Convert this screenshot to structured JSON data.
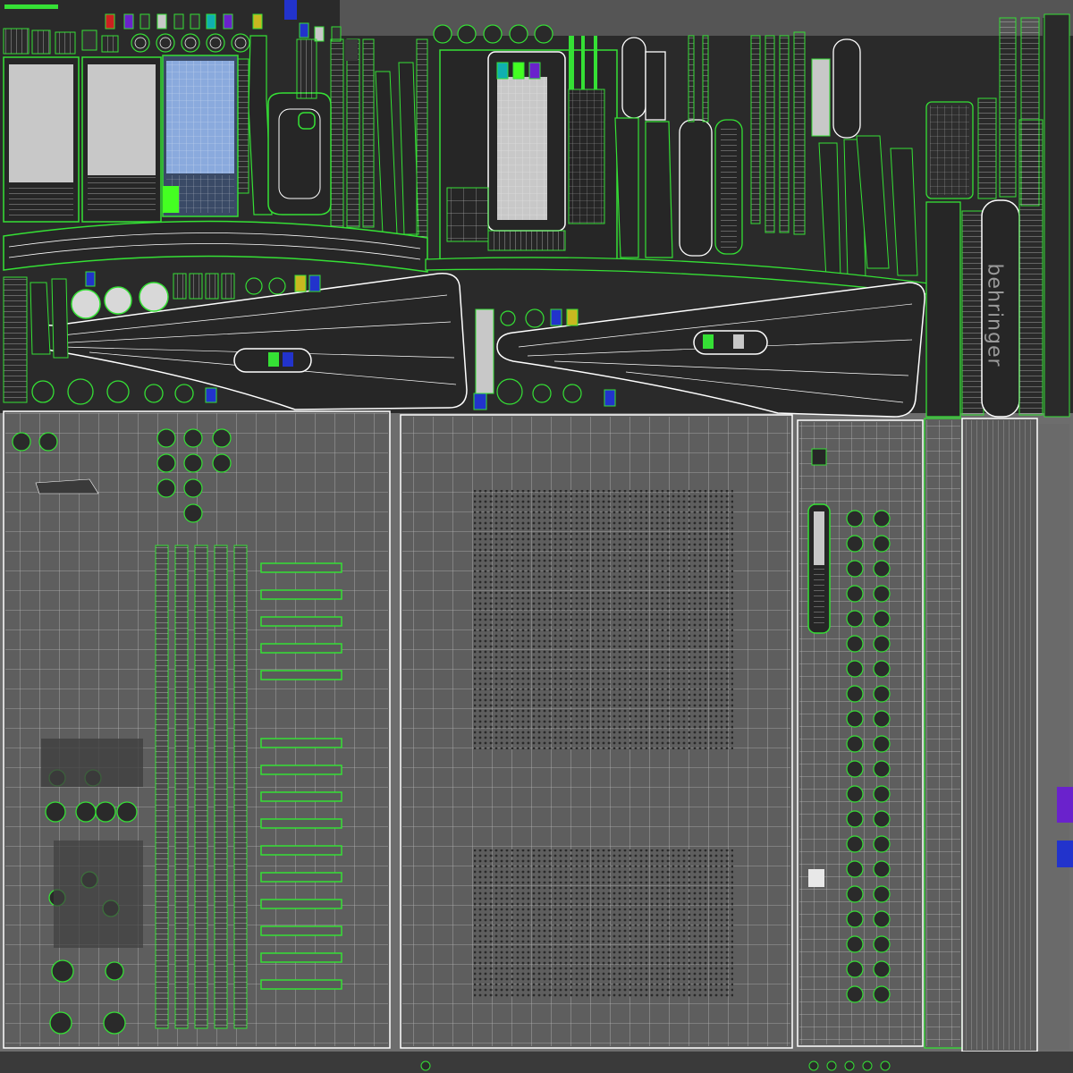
{
  "sheet": {
    "brand_label": "behringer",
    "colors": {
      "background": "#6d6d6d",
      "dark_panel": "#262626",
      "wire_white": "#ffffff",
      "seam_green": "#35e035",
      "light_gray": "#c8c8c8",
      "blue_swatch": "#2233cc",
      "purple_swatch": "#6a22cc",
      "red_swatch": "#cc2020",
      "cyan_swatch": "#10b0b0",
      "yellow_swatch": "#c8b820",
      "bright_green_swatch": "#44ff22",
      "sky_blue_panel": "#8aaadd"
    },
    "islands": [
      "swatch-row-top",
      "label-strips-left",
      "gray-panels-top-left",
      "blue-lcd-panel",
      "center-top-frame",
      "vertical-strips-right",
      "long-curved-strip",
      "left-body-shell",
      "right-body-shell",
      "left-mixer-panel",
      "center-grid-panel",
      "right-channel-panel",
      "right-side-strip"
    ]
  }
}
